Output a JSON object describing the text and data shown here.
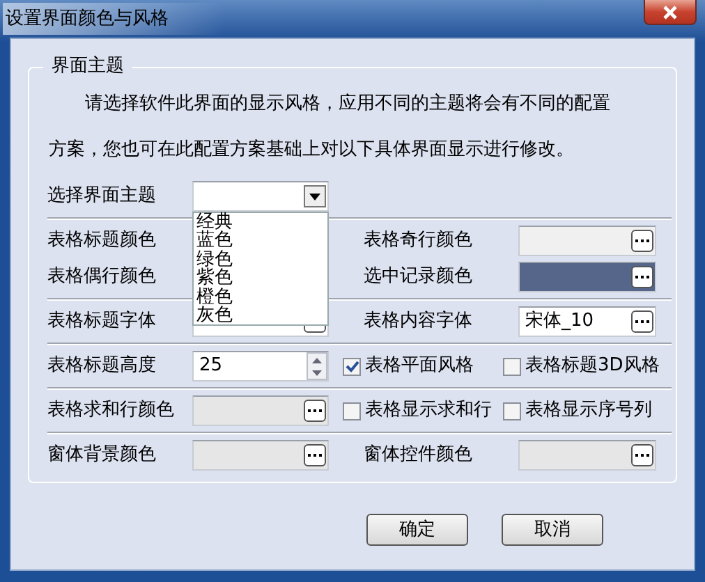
{
  "window": {
    "title": "设置界面颜色与风格"
  },
  "group": {
    "title": "界面主题",
    "description": "请选择软件此界面的显示风格，应用不同的主题将会有不同的配置方案，您也可在此配置方案基础上对以下具体界面显示进行修改。",
    "theme": {
      "label": "选择界面主题",
      "expanded": true,
      "options": [
        "经典",
        "蓝色",
        "绿色",
        "紫色",
        "橙色",
        "灰色"
      ]
    },
    "sections": [
      [
        [
          {
            "kind": "label",
            "text": "表格标题颜色"
          },
          {
            "kind": "hidden"
          },
          {
            "kind": "label",
            "text": "表格奇行颜色"
          },
          {
            "kind": "color",
            "color": "#f0f0f0"
          }
        ],
        [
          {
            "kind": "label",
            "text": "表格偶行颜色"
          },
          {
            "kind": "hidden"
          },
          {
            "kind": "label",
            "text": "选中记录颜色"
          },
          {
            "kind": "color",
            "color": "#56658a"
          }
        ]
      ],
      [
        [
          {
            "kind": "label",
            "text": "表格标题字体"
          },
          {
            "kind": "font"
          },
          {
            "kind": "label",
            "text": "表格内容字体"
          },
          {
            "kind": "font",
            "value": "宋体_10"
          }
        ]
      ],
      [
        [
          {
            "kind": "label",
            "text": "表格标题高度"
          },
          {
            "kind": "spin",
            "value": "25"
          },
          {
            "kind": "check",
            "text": "表格平面风格",
            "checked": true
          },
          {
            "kind": "check",
            "text": "表格标题3D风格",
            "checked": false
          }
        ]
      ],
      [
        [
          {
            "kind": "label",
            "text": "表格求和行颜色"
          },
          {
            "kind": "color",
            "color": "#e6e6e6"
          },
          {
            "kind": "check",
            "text": "表格显示求和行",
            "checked": false
          },
          {
            "kind": "check",
            "text": "表格显示序号列",
            "checked": false
          }
        ]
      ],
      [
        [
          {
            "kind": "label",
            "text": "窗体背景颜色"
          },
          {
            "kind": "color",
            "color": "#e6e6e6"
          },
          {
            "kind": "label",
            "text": "窗体控件颜色"
          },
          {
            "kind": "color",
            "color": "#e6e6e6"
          }
        ]
      ]
    ]
  },
  "buttons": [
    "确定",
    "取消"
  ]
}
